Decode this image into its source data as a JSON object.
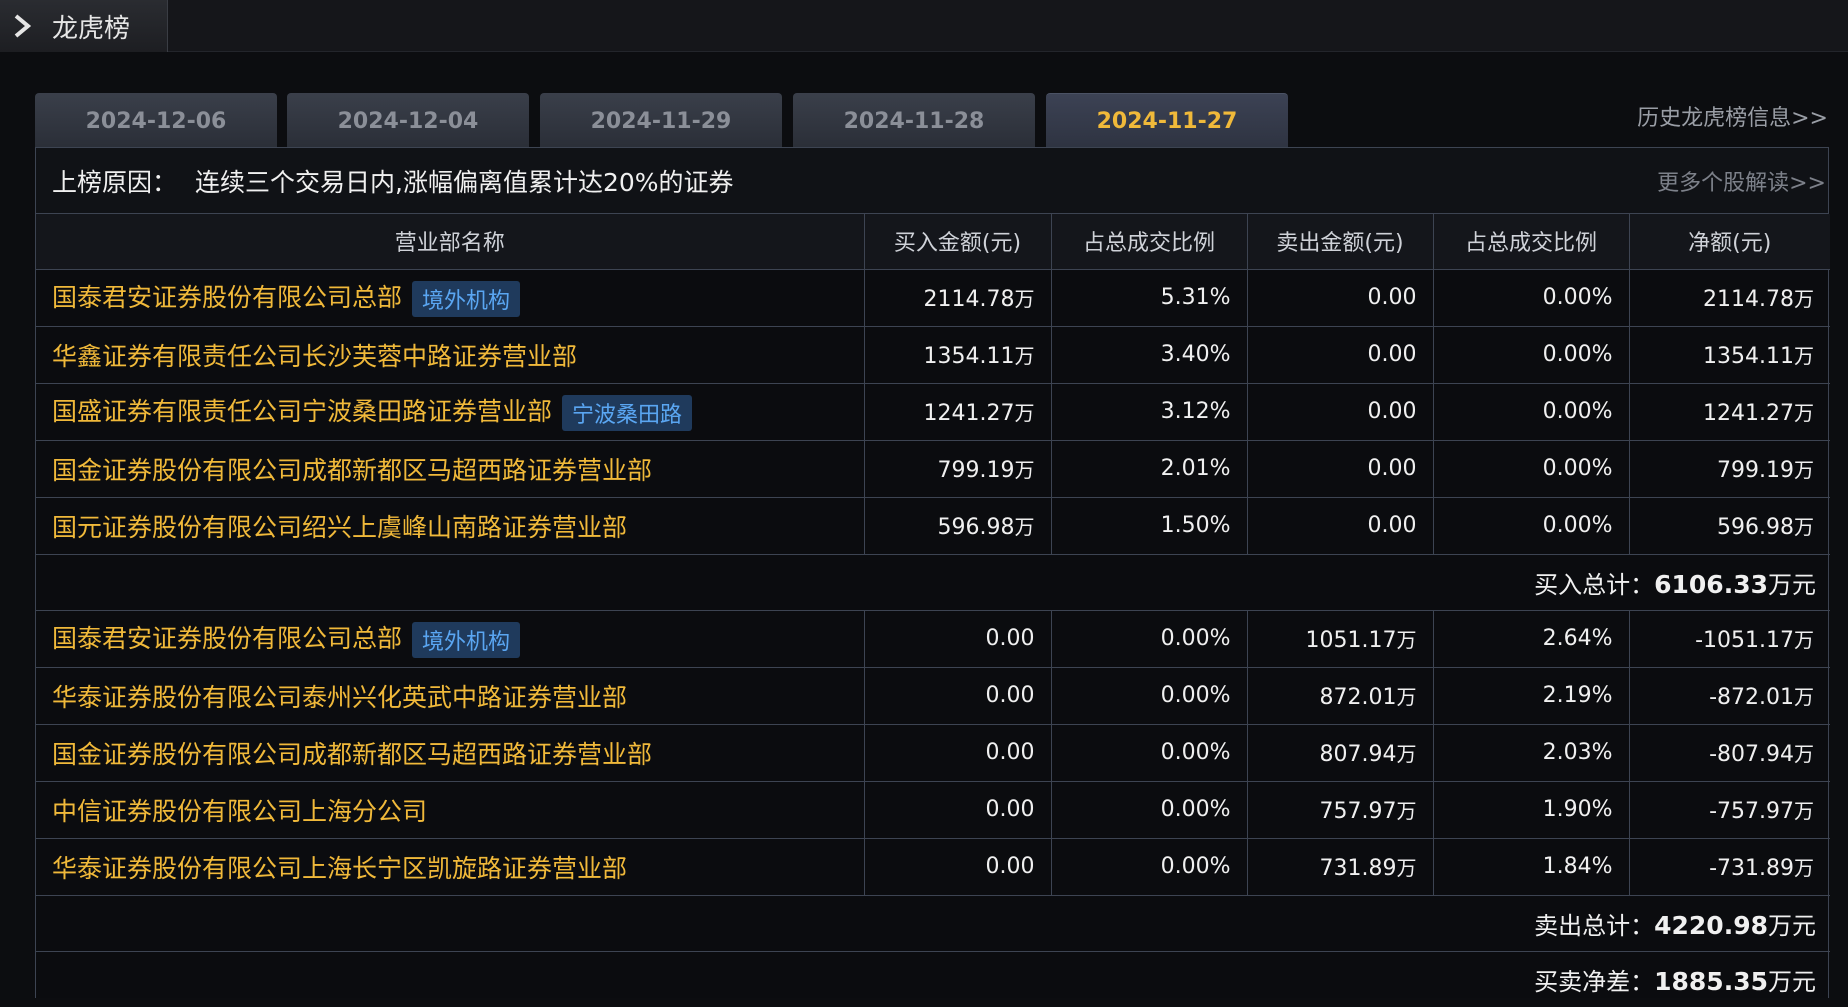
{
  "panel": {
    "title": "龙虎榜",
    "icon": "chevron-right-icon"
  },
  "tabs": [
    {
      "label": "2024-12-06",
      "active": false
    },
    {
      "label": "2024-12-04",
      "active": false
    },
    {
      "label": "2024-11-29",
      "active": false
    },
    {
      "label": "2024-11-28",
      "active": false
    },
    {
      "label": "2024-11-27",
      "active": true
    }
  ],
  "history_link": "历史龙虎榜信息>>",
  "reason": {
    "label": "上榜原因：",
    "text": "连续三个交易日内,涨幅偏离值累计达20%的证券",
    "more": "更多个股解读>>"
  },
  "columns": [
    "营业部名称",
    "买入金额(元)",
    "占总成交比例",
    "卖出金额(元)",
    "占总成交比例",
    "净额(元)"
  ],
  "buy_rows": [
    {
      "name": "国泰君安证券股份有限公司总部",
      "badge": "境外机构",
      "buy": "2114.78",
      "buy_unit": "万",
      "buy_pct": "5.31%",
      "sell": "0.00",
      "sell_unit": "",
      "sell_pct": "0.00%",
      "net": "2114.78",
      "net_unit": "万"
    },
    {
      "name": "华鑫证券有限责任公司长沙芙蓉中路证券营业部",
      "badge": "",
      "buy": "1354.11",
      "buy_unit": "万",
      "buy_pct": "3.40%",
      "sell": "0.00",
      "sell_unit": "",
      "sell_pct": "0.00%",
      "net": "1354.11",
      "net_unit": "万"
    },
    {
      "name": "国盛证券有限责任公司宁波桑田路证券营业部",
      "badge": "宁波桑田路",
      "buy": "1241.27",
      "buy_unit": "万",
      "buy_pct": "3.12%",
      "sell": "0.00",
      "sell_unit": "",
      "sell_pct": "0.00%",
      "net": "1241.27",
      "net_unit": "万"
    },
    {
      "name": "国金证券股份有限公司成都新都区马超西路证券营业部",
      "badge": "",
      "buy": "799.19",
      "buy_unit": "万",
      "buy_pct": "2.01%",
      "sell": "0.00",
      "sell_unit": "",
      "sell_pct": "0.00%",
      "net": "799.19",
      "net_unit": "万"
    },
    {
      "name": "国元证券股份有限公司绍兴上虞峰山南路证券营业部",
      "badge": "",
      "buy": "596.98",
      "buy_unit": "万",
      "buy_pct": "1.50%",
      "sell": "0.00",
      "sell_unit": "",
      "sell_pct": "0.00%",
      "net": "596.98",
      "net_unit": "万"
    }
  ],
  "buy_total": {
    "label": "买入总计：",
    "value": "6106.33",
    "unit": "万元"
  },
  "sell_rows": [
    {
      "name": "国泰君安证券股份有限公司总部",
      "badge": "境外机构",
      "buy": "0.00",
      "buy_unit": "",
      "buy_pct": "0.00%",
      "sell": "1051.17",
      "sell_unit": "万",
      "sell_pct": "2.64%",
      "net": "-1051.17",
      "net_unit": "万"
    },
    {
      "name": "华泰证券股份有限公司泰州兴化英武中路证券营业部",
      "badge": "",
      "buy": "0.00",
      "buy_unit": "",
      "buy_pct": "0.00%",
      "sell": "872.01",
      "sell_unit": "万",
      "sell_pct": "2.19%",
      "net": "-872.01",
      "net_unit": "万"
    },
    {
      "name": "国金证券股份有限公司成都新都区马超西路证券营业部",
      "badge": "",
      "buy": "0.00",
      "buy_unit": "",
      "buy_pct": "0.00%",
      "sell": "807.94",
      "sell_unit": "万",
      "sell_pct": "2.03%",
      "net": "-807.94",
      "net_unit": "万"
    },
    {
      "name": "中信证券股份有限公司上海分公司",
      "badge": "",
      "buy": "0.00",
      "buy_unit": "",
      "buy_pct": "0.00%",
      "sell": "757.97",
      "sell_unit": "万",
      "sell_pct": "1.90%",
      "net": "-757.97",
      "net_unit": "万"
    },
    {
      "name": "华泰证券股份有限公司上海长宁区凯旋路证券营业部",
      "badge": "",
      "buy": "0.00",
      "buy_unit": "",
      "buy_pct": "0.00%",
      "sell": "731.89",
      "sell_unit": "万",
      "sell_pct": "1.84%",
      "net": "-731.89",
      "net_unit": "万"
    }
  ],
  "sell_total": {
    "label": "卖出总计：",
    "value": "4220.98",
    "unit": "万元"
  },
  "net_total": {
    "label": "买卖净差：",
    "value": "1885.35",
    "unit": "万元"
  },
  "colors": {
    "accent": "#f0b93a",
    "badge_text": "#5aa6f2",
    "badge_bg": "#1f3a5c",
    "border": "#3d4452"
  }
}
